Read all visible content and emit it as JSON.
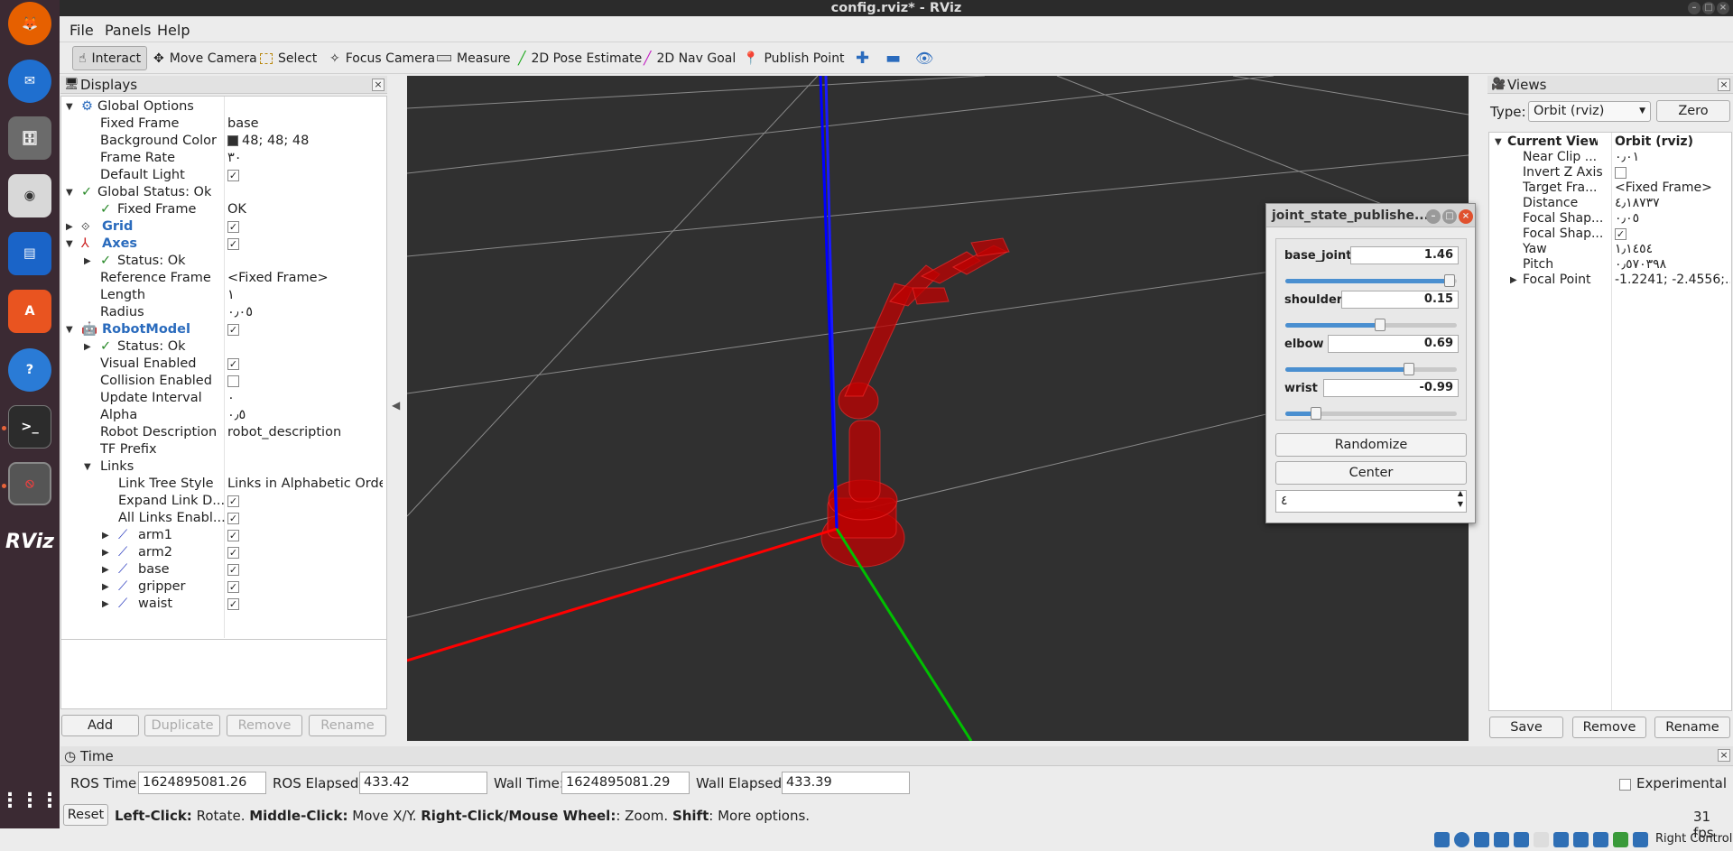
{
  "window": {
    "title": "config.rviz* - RViz"
  },
  "menu": [
    "File",
    "Panels",
    "Help"
  ],
  "toolbar": {
    "interact": "Interact",
    "move_camera": "Move Camera",
    "select": "Select",
    "focus_camera": "Focus Camera",
    "measure": "Measure",
    "pose_estimate": "2D Pose Estimate",
    "nav_goal": "2D Nav Goal",
    "publish_point": "Publish Point"
  },
  "displays": {
    "title": "Displays",
    "global_options": "Global Options",
    "fixed_frame_label": "Fixed Frame",
    "fixed_frame_value": "base",
    "bg_color_label": "Background Color",
    "bg_color_value": "48; 48; 48",
    "frame_rate_label": "Frame Rate",
    "frame_rate_value": "٣٠",
    "default_light_label": "Default Light",
    "global_status": "Global Status: Ok",
    "gs_fixed_frame": "Fixed Frame",
    "gs_fixed_frame_value": "OK",
    "grid": "Grid",
    "axes": "Axes",
    "axes_status": "Status: Ok",
    "ref_frame_label": "Reference Frame",
    "ref_frame_value": "<Fixed Frame>",
    "length_label": "Length",
    "length_value": "١",
    "radius_label": "Radius",
    "radius_value": "٠٫٠٥",
    "robot_model": "RobotModel",
    "rm_status": "Status: Ok",
    "visual_label": "Visual Enabled",
    "collision_label": "Collision Enabled",
    "update_label": "Update Interval",
    "update_value": "٠",
    "alpha_label": "Alpha",
    "alpha_value": "٠٫٥",
    "robot_desc_label": "Robot Description",
    "robot_desc_value": "robot_description",
    "tf_prefix_label": "TF Prefix",
    "links": "Links",
    "link_tree_label": "Link Tree Style",
    "link_tree_value": "Links in Alphabetic Order",
    "expand_label": "Expand Link D...",
    "all_links_label": "All Links Enabl...",
    "link_items": [
      "arm1",
      "arm2",
      "base",
      "gripper",
      "waist"
    ],
    "buttons": {
      "add": "Add",
      "duplicate": "Duplicate",
      "remove": "Remove",
      "rename": "Rename"
    }
  },
  "views": {
    "title": "Views",
    "type_label": "Type:",
    "type_value": "Orbit (rviz)",
    "zero": "Zero",
    "current_view": "Current View",
    "current_view_value": "Orbit (rviz)",
    "near_clip": "Near Clip ...",
    "near_clip_value": "٠٫٠١",
    "invert_z": "Invert Z Axis",
    "target_frame": "Target Fra...",
    "target_frame_value": "<Fixed Frame>",
    "distance": "Distance",
    "distance_value": "٤٫١٨٧٣٧",
    "focal_shape_1": "Focal Shap...",
    "focal_shape_1_value": "٠٫٠٥",
    "focal_shape_2": "Focal Shap...",
    "yaw": "Yaw",
    "yaw_value": "١٫١٤٥٤",
    "pitch": "Pitch",
    "pitch_value": "٠٫٥٧٠٣٩٨",
    "focal_point": "Focal Point",
    "focal_point_value": "-1.2241; -2.4556;...",
    "buttons": {
      "save": "Save",
      "remove": "Remove",
      "rename": "Rename"
    }
  },
  "jsp": {
    "title": "joint_state_publishe...",
    "joints": [
      {
        "name": "base_joint",
        "value": "1.46",
        "fraction": 0.96
      },
      {
        "name": "shoulder",
        "value": "0.15",
        "fraction": 0.55
      },
      {
        "name": "elbow",
        "value": "0.69",
        "fraction": 0.72
      },
      {
        "name": "wrist",
        "value": "-0.99",
        "fraction": 0.18
      }
    ],
    "randomize": "Randomize",
    "center": "Center",
    "spin_value": "٤"
  },
  "time": {
    "title": "Time",
    "ros_time_label": "ROS Time:",
    "ros_time": "1624895081.26",
    "ros_elapsed_label": "ROS Elapsed:",
    "ros_elapsed": "433.42",
    "wall_time_label": "Wall Time:",
    "wall_time": "1624895081.29",
    "wall_elapsed_label": "Wall Elapsed:",
    "wall_elapsed": "433.39",
    "experimental": "Experimental"
  },
  "status": {
    "reset": "Reset",
    "hint_1": "Left-Click:",
    "hint_1b": " Rotate. ",
    "hint_2": "Middle-Click:",
    "hint_2b": " Move X/Y. ",
    "hint_3": "Right-Click/Mouse Wheel:",
    "hint_3b": ": Zoom. ",
    "hint_4": "Shift",
    "hint_4b": ": More options.",
    "fps": "31 fps",
    "right_control": "Right Control"
  },
  "colors": {
    "viewport_bg": "#303030",
    "x_axis": "#ff0000",
    "y_axis": "#00c000",
    "z_axis": "#0000ff",
    "robot": "#c00000",
    "dock": "#3b2a33"
  }
}
